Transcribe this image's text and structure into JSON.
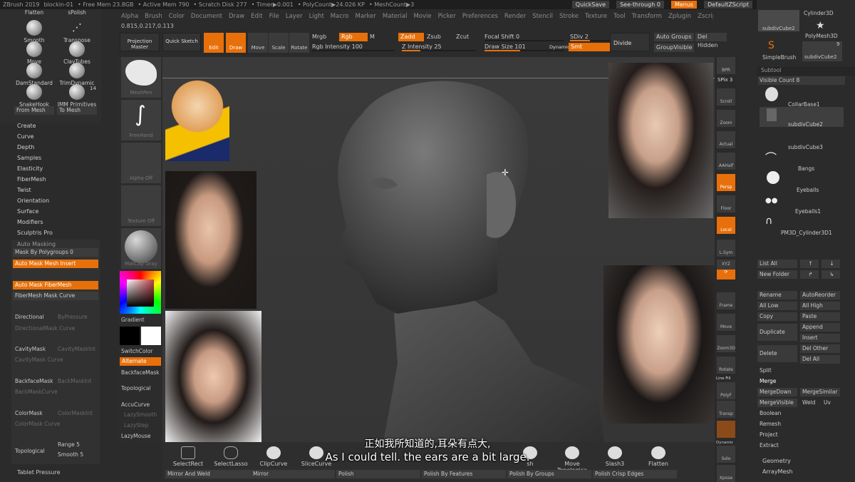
{
  "titlebar": {
    "app": "ZBrush 2019",
    "file": "blockin-01",
    "free_mem": "• Free Mem 23.8GB",
    "active_mem": "• Active Mem 790",
    "scratch": "• Scratch Disk 277",
    "timer": "• Timer▶0.001",
    "polycount": "• PolyCount▶24.026 KP",
    "meshcount": "• MeshCount▶3",
    "quicksave": "QuickSave",
    "seethrough": "See-through 0",
    "menus": "Menus",
    "defaultscript": "DefaultZScript"
  },
  "menubar": [
    "Alpha",
    "Brush",
    "Color",
    "Document",
    "Draw",
    "Edit",
    "File",
    "Layer",
    "Light",
    "Macro",
    "Marker",
    "Material",
    "Movie",
    "Picker",
    "Preferences",
    "Render",
    "Stencil",
    "Stroke",
    "Texture",
    "Tool",
    "Transform",
    "Zplugin",
    "Zscript"
  ],
  "coords": "0.815,0.217,0.113",
  "brushes": [
    {
      "label": "Flatten"
    },
    {
      "label": "sPolish"
    },
    {
      "label": "Smooth"
    },
    {
      "label": "Transpose"
    },
    {
      "label": "Move"
    },
    {
      "label": "ClayTubes"
    },
    {
      "label": "DamStandard"
    },
    {
      "label": "TrimDynamic"
    },
    {
      "label": "SnakeHook"
    },
    {
      "label": "IMM Primitives"
    }
  ],
  "brush_count": "14",
  "from_mesh": "From Mesh",
  "to_mesh": "To Mesh",
  "left_menu": [
    "Create",
    "Curve",
    "Depth",
    "Samples",
    "Elasticity",
    "FiberMesh",
    "Twist",
    "Orientation",
    "Surface",
    "Modifiers",
    "Sculptris Pro"
  ],
  "automasking": {
    "title": "Auto Masking",
    "mask_polygroups": "Mask By Polygroups 0",
    "mesh_insert": "Auto Mask Mesh Insert",
    "fibermesh": "Auto Mask FiberMesh",
    "fiber_curve": "FiberMesh Mask Curve",
    "directional": "Directional",
    "byfeature": "ByPressure",
    "dir_curve": "DirectionalMask Curve",
    "cavity": "CavityMask",
    "cavity_int": "CavityMaskInt",
    "cavity_curve": "CavityMask Curve",
    "backface": "BackfaceMask",
    "backface_int": "BackMaskInt",
    "backface_curve": "BackMaskCurve",
    "color": "ColorMask",
    "color_int": "ColorMaskInt",
    "color_curve": "ColorMask Curve",
    "topological": "Topological",
    "range": "Range 5",
    "smooth": "Smooth 5",
    "tablet": "Tablet Pressure"
  },
  "shelf": {
    "projection": "Projection Master",
    "quick": "Quick Sketch",
    "edit": "Edit",
    "draw": "Draw",
    "move": "Move",
    "scale": "Scale",
    "rotate": "Rotate",
    "mrgb": "Mrgb",
    "rgb": "Rgb",
    "m": "M",
    "rgb_int": "Rgb Intensity 100",
    "zadd": "Zadd",
    "zsub": "Zsub",
    "zcut": "Zcut",
    "z_int": "Z Intensity 25",
    "focal": "Focal Shift 0",
    "drawsize": "Draw Size 101",
    "dynamic": "Dynamic",
    "sdiv": "SDiv 2",
    "smt": "Smt",
    "divide": "Divide",
    "autogroups": "Auto Groups",
    "delhidden": "Del Hidden",
    "groupvisible": "GroupVisible"
  },
  "tray": {
    "meshpen": "MeshPen",
    "freehand": "FreeHand",
    "alphaoff": "Alpha Off",
    "textureoff": "Texture Off",
    "matcap": "MatCap Gray",
    "gradient": "Gradient",
    "switchcolor": "SwitchColor",
    "alternate": "Alternate",
    "backfacemask": "BackfaceMask",
    "topological": "Topological",
    "accucurve": "AccuCurve",
    "lazysmooth": "LazySmooth",
    "lazystep": "LazyStep",
    "lazymouse": "LazyMouse"
  },
  "rightshelf": {
    "bpr": "BPR",
    "spix": "SPix 3",
    "scroll": "Scroll",
    "zoom": "Zoom",
    "actual": "Actual",
    "aahalf": "AAHalf",
    "persp": "Persp",
    "floor": "Floor",
    "local": "Local",
    "lsym": "L.Sym",
    "xyz": "XYZ",
    "frame": "Frame",
    "move": "Move",
    "zoom3d": "Zoom3D",
    "rotate": "Rotate",
    "linefill": "Line Fill",
    "polyf": "PolyF",
    "transp": "Transp",
    "dynamic": "Dynamic",
    "solo": "Solo",
    "xpose": "Xpose"
  },
  "tool": {
    "cylinder3d": "Cylinder3D",
    "subdivcube2": "subdivCube2",
    "polymesh": "PolyMesh3D",
    "simplebrush": "SimpleBrush",
    "subdivcube2b": "subdivCube2",
    "count": "9",
    "count2": "2"
  },
  "subtool": {
    "title": "Subtool",
    "visible": "Visible Count 8",
    "items": [
      "CollarBase1",
      "subdivCube2",
      "subdivCube3",
      "Bangs",
      "Eyeballs",
      "Eyeballs1",
      "PM3D_Cylinder3D1"
    ],
    "listall": "List All",
    "newfolder": "New Folder",
    "rename": "Rename",
    "autoreorder": "AutoReorder",
    "alllow": "All Low",
    "allhigh": "All High",
    "copy": "Copy",
    "paste": "Paste",
    "duplicate": "Duplicate",
    "append": "Append",
    "insert": "Insert",
    "delete": "Delete",
    "delother": "Del Other",
    "delall": "Del All",
    "split": "Split",
    "merge": "Merge",
    "mergedown": "MergeDown",
    "mergesimilar": "MergeSimilar",
    "mergevisible": "MergeVisible",
    "weld": "Weld",
    "uv": "Uv",
    "boolean": "Boolean",
    "remesh": "Remesh",
    "project": "Project",
    "extract": "Extract",
    "geometry": "Geometry",
    "arraymesh": "ArrayMesh"
  },
  "bottom": {
    "selectrect": "SelectRect",
    "selectlasso": "SelectLasso",
    "clipcurve": "ClipCurve",
    "slicecurve": "SliceCurve",
    "trimcurve": "sh",
    "movetopo": "Move Topologica",
    "slash3": "Slash3",
    "flatten": "Flatten",
    "mirrorweld": "Mirror And Weld",
    "mirror": "Mirror",
    "polish": "Polish",
    "polishfeatures": "Polish By Features",
    "polishgroups": "Polish By Groups",
    "polishcrisp": "Polish Crisp Edges"
  },
  "subtitle": {
    "zh": "正如我所知道的,耳朵有点大,",
    "en": "As I could tell. the ears are a bit large."
  },
  "colors": {
    "accent": "#e8700a",
    "bg": "#2b2b2b"
  }
}
